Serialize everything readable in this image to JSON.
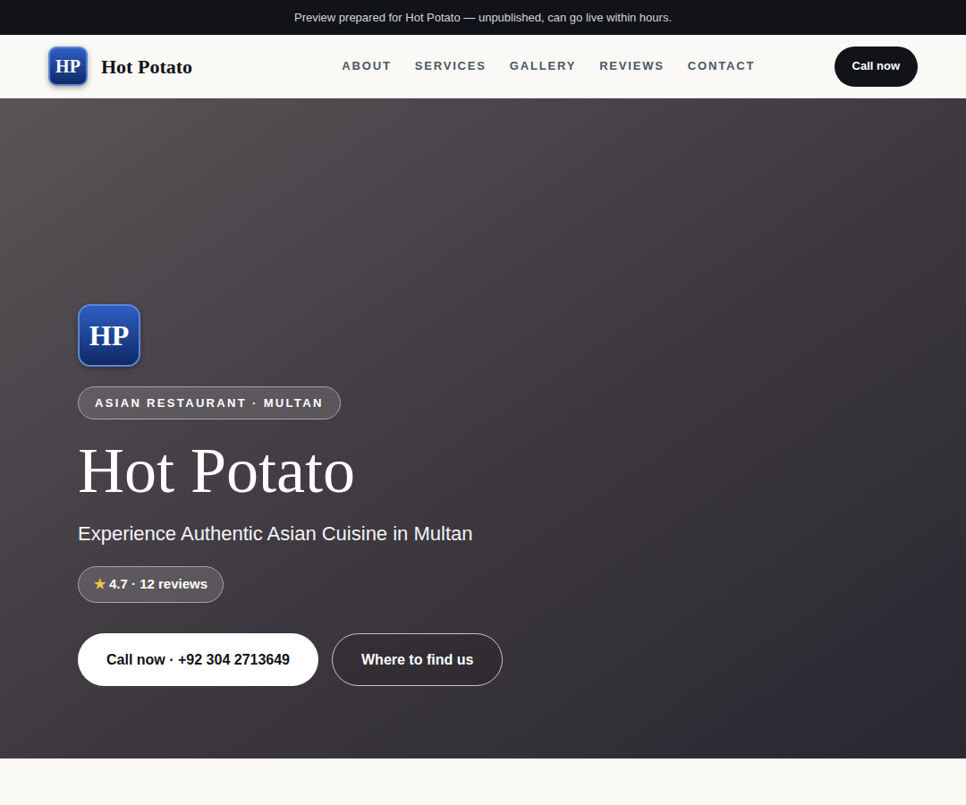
{
  "banner": {
    "text": "Preview prepared for Hot Potato — unpublished, can go live within hours."
  },
  "header": {
    "logo": "HP",
    "brand": "Hot Potato",
    "nav": [
      {
        "label": "ABOUT",
        "selected": false
      },
      {
        "label": "SERVICES",
        "selected": false
      },
      {
        "label": "GALLERY",
        "selected": false
      },
      {
        "label": "REVIEWS",
        "selected": false
      },
      {
        "label": "CONTACT",
        "selected": false
      }
    ],
    "button": "Call now"
  },
  "hero": {
    "logo": "HP",
    "badge": "ASIAN RESTAURANT · MULTAN",
    "title": "Hot Potato",
    "subtitle": "Experience Authentic Asian Cuisine in Multan",
    "rating": {
      "star": "★",
      "text": "4.7 · 12 reviews"
    },
    "buttons": [
      {
        "label": "Call now · +92 304 2713649",
        "kind": "primary"
      },
      {
        "label": "Where to find us",
        "kind": "secondary"
      }
    ]
  }
}
